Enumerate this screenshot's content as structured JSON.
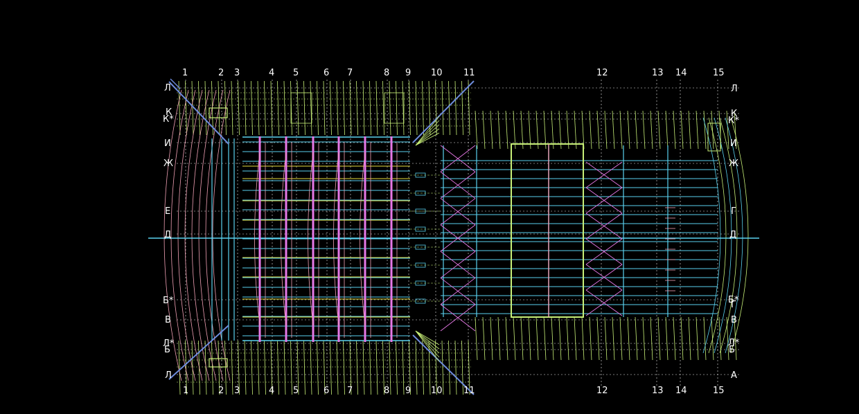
{
  "drawing": {
    "background": "#000000",
    "colors": {
      "grid": "#f0f0f0",
      "lime": "#c8f078",
      "pink": "#f0a0b4",
      "cyan": "#5ad2f0",
      "blue": "#6e8cdc",
      "magenta": "#e678e6",
      "yellow": "#e6dc3c",
      "label": "#ffffff"
    },
    "column_axes": [
      "1",
      "2",
      "3",
      "4",
      "5",
      "6",
      "7",
      "8",
      "9",
      "10",
      "11",
      "12",
      "13",
      "14",
      "15"
    ],
    "row_axes_left": [
      "Л",
      "К",
      "К*",
      "И",
      "Ж",
      "Е",
      "Д",
      "Б*",
      "В",
      "Л*",
      "Б",
      "Л"
    ],
    "row_axes_right": [
      "Л",
      "К",
      "К*",
      "И",
      "Ж",
      "Г",
      "Д",
      "Б*",
      "Г",
      "В",
      "Л*",
      "Б",
      "А"
    ]
  }
}
